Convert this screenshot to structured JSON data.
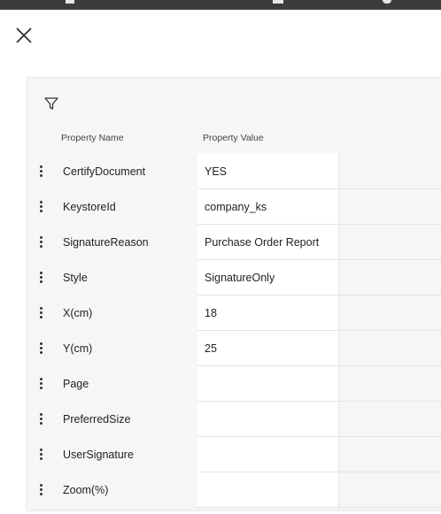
{
  "window": {
    "close_icon": "close-icon"
  },
  "panel": {
    "filter_icon": "filter-icon",
    "columns": {
      "name": "Property Name",
      "value": "Property Value"
    },
    "rows": [
      {
        "name": "CertifyDocument",
        "value": "YES"
      },
      {
        "name": "KeystoreId",
        "value": "company_ks"
      },
      {
        "name": "SignatureReason",
        "value": "Purchase Order Report"
      },
      {
        "name": "Style",
        "value": "SignatureOnly"
      },
      {
        "name": "X(cm)",
        "value": "18"
      },
      {
        "name": "Y(cm)",
        "value": "25"
      },
      {
        "name": "Page",
        "value": ""
      },
      {
        "name": "PreferredSize",
        "value": ""
      },
      {
        "name": "UserSignature",
        "value": ""
      },
      {
        "name": "Zoom(%)",
        "value": ""
      }
    ]
  }
}
